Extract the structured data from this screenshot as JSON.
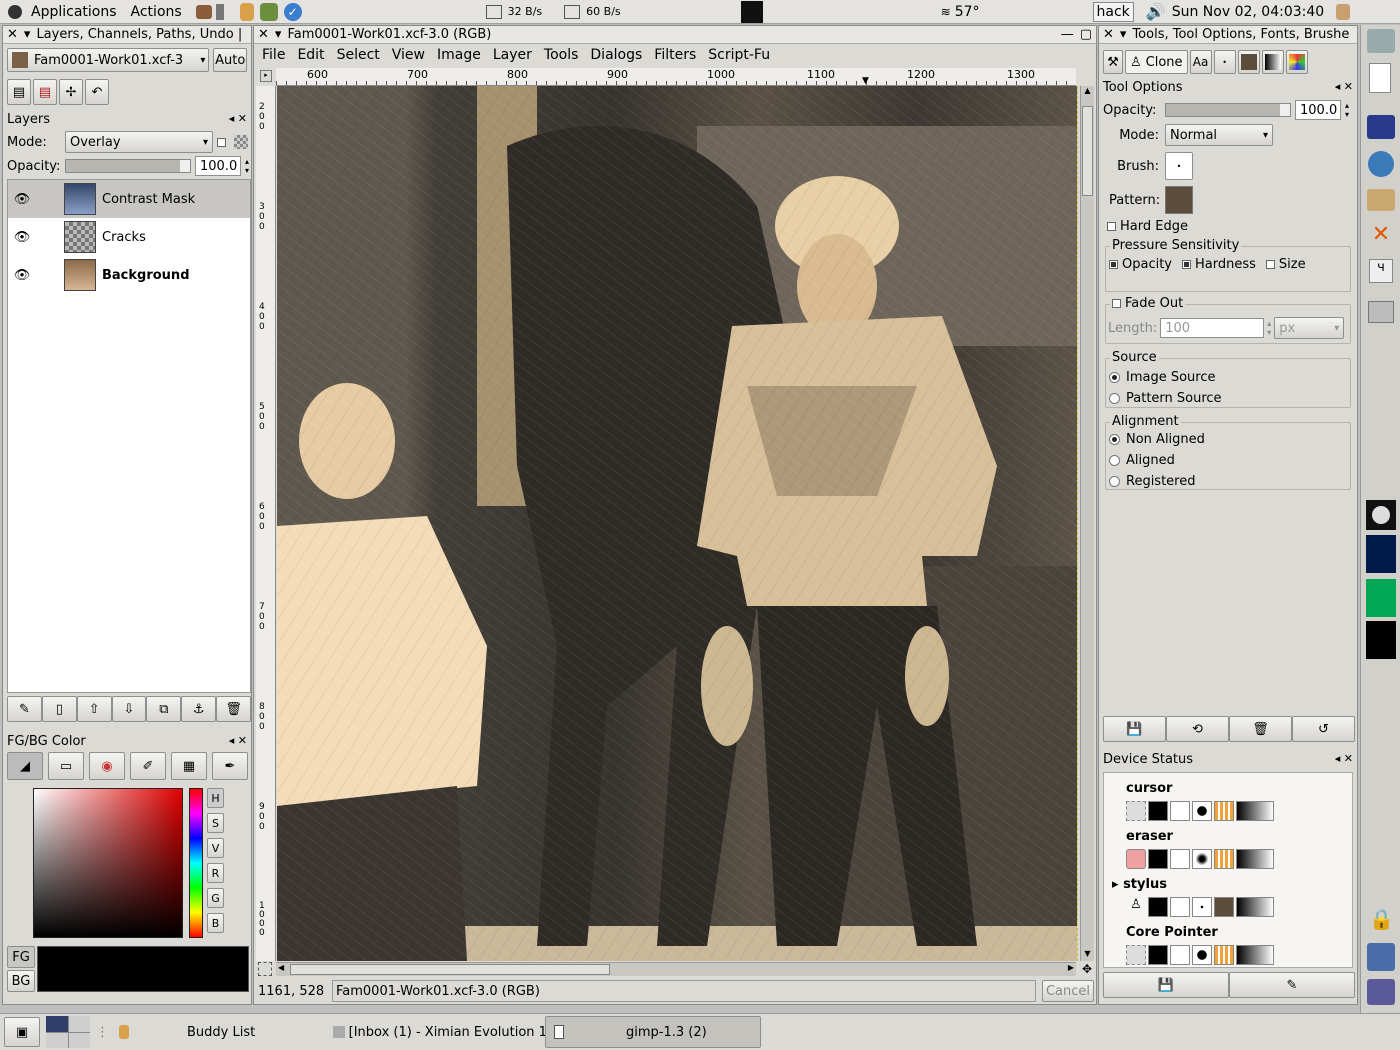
{
  "top_panel": {
    "applications": "Applications",
    "actions": "Actions",
    "net_down": "32 B/s",
    "net_up": "60 B/s",
    "temperature": "57°",
    "hostname": "hack",
    "datetime": "Sun Nov 02, 04:03:40"
  },
  "layers_dock": {
    "title": "Layers, Channels, Paths, Undo |",
    "image_selector": "Fam0001-Work01.xcf-3",
    "auto_label": "Auto",
    "layers_header": "Layers",
    "mode_label": "Mode:",
    "mode_value": "Overlay",
    "opacity_label": "Opacity:",
    "opacity_value": "100.0",
    "layers": [
      {
        "name": "Contrast Mask",
        "selected": true
      },
      {
        "name": "Cracks",
        "selected": false
      },
      {
        "name": "Background",
        "selected": false
      }
    ]
  },
  "fgbg": {
    "title": "FG/BG Color",
    "channels": [
      "H",
      "S",
      "V",
      "R",
      "G",
      "B"
    ],
    "fg_label": "FG",
    "bg_label": "BG"
  },
  "image_window": {
    "title": "Fam0001-Work01.xcf-3.0 (RGB)",
    "menu": [
      "File",
      "Edit",
      "Select",
      "View",
      "Image",
      "Layer",
      "Tools",
      "Dialogs",
      "Filters",
      "Script-Fu"
    ],
    "ruler_marks": [
      "600",
      "700",
      "800",
      "900",
      "1000",
      "1100",
      "1200",
      "1300"
    ],
    "vruler_marks": [
      "200",
      "300",
      "400",
      "500",
      "600",
      "700",
      "800",
      "900",
      "1000"
    ],
    "coords": "1161, 528",
    "status": "Fam0001-Work01.xcf-3.0 (RGB)",
    "cancel": "Cancel"
  },
  "tools_dock": {
    "title": "Tools, Tool Options, Fonts, Brushe",
    "clone_label": "Clone",
    "font_tab": "Aa",
    "tool_options_header": "Tool Options",
    "opacity_label": "Opacity:",
    "opacity_value": "100.0",
    "mode_label": "Mode:",
    "mode_value": "Normal",
    "brush_label": "Brush:",
    "pattern_label": "Pattern:",
    "hard_edge": "Hard Edge",
    "pressure_title": "Pressure Sensitivity",
    "pressure_opacity": "Opacity",
    "pressure_hardness": "Hardness",
    "pressure_size": "Size",
    "fade_out": "Fade Out",
    "length_label": "Length:",
    "length_value": "100",
    "length_unit": "px",
    "source_title": "Source",
    "source_image": "Image Source",
    "source_pattern": "Pattern Source",
    "alignment_title": "Alignment",
    "align_non": "Non Aligned",
    "align_aligned": "Aligned",
    "align_registered": "Registered",
    "device_status": "Device Status",
    "devices": [
      "cursor",
      "eraser",
      "stylus",
      "Core Pointer"
    ]
  },
  "taskbar": {
    "buddy_list": "Buddy List",
    "evolution": "[Inbox (1) - Ximian Evolution 1.",
    "gimp": "gimp-1.3 (2)"
  }
}
